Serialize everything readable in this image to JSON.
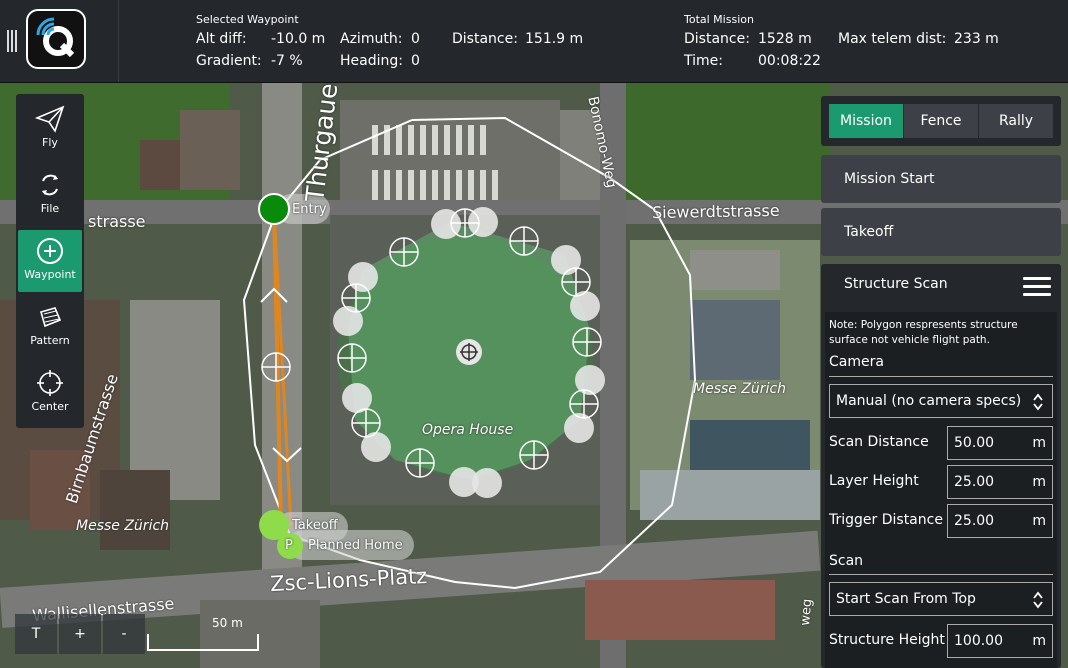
{
  "selected_waypoint": {
    "header": "Selected Waypoint",
    "alt_diff_label": "Alt diff:",
    "alt_diff_value": "-10.0 m",
    "azimuth_label": "Azimuth:",
    "azimuth_value": "0",
    "distance_label": "Distance:",
    "distance_value": "151.9 m",
    "gradient_label": "Gradient:",
    "gradient_value": "-7 %",
    "heading_label": "Heading:",
    "heading_value": "0"
  },
  "total_mission": {
    "header": "Total Mission",
    "distance_label": "Distance:",
    "distance_value": "1528 m",
    "max_telem_label": "Max telem dist:",
    "max_telem_value": "233 m",
    "time_label": "Time:",
    "time_value": "00:08:22"
  },
  "toolstrip": {
    "fly": "Fly",
    "file": "File",
    "waypoint": "Waypoint",
    "pattern": "Pattern",
    "center": "Center"
  },
  "tabs": [
    "Mission",
    "Fence",
    "Rally"
  ],
  "mission_items": {
    "mission_start": "Mission Start",
    "takeoff": "Takeoff"
  },
  "structure_scan": {
    "title": "Structure Scan",
    "note": "Note: Polygon respresents structure surface not vehicle flight path.",
    "camera_section": "Camera",
    "camera_value": "Manual (no camera specs)",
    "scan_distance_label": "Scan Distance",
    "scan_distance_value": "50.00",
    "layer_height_label": "Layer Height",
    "layer_height_value": "25.00",
    "trigger_distance_label": "Trigger Distance",
    "trigger_distance_value": "25.00",
    "unit": "m",
    "scan_section": "Scan",
    "scan_from_value": "Start Scan From Top",
    "structure_height_label": "Structure Height",
    "structure_height_value": "100.00"
  },
  "map": {
    "labels": {
      "thurgauerstrasse": "Thurgauerstrasse",
      "siewerdtstrasse": "Siewerdtstrasse",
      "bonomo_weg": "Bonomo-Weg",
      "birnbaumstrasse": "Birnbaumstrasse",
      "messe_zurich_1": "Messe Zürich",
      "messe_zurich_2": "Messe Zürich",
      "opera_house": "Opera House",
      "zsc_lions_platz": "Zsc-Lions-Platz",
      "wallisellenstrasse": "Wallisellenstrasse",
      "strasse_left": "strasse",
      "weg_bottom": "weg"
    },
    "markers": {
      "entry": "Entry",
      "takeoff": "Takeoff",
      "planned_home_letter": "P",
      "planned_home": "Planned Home"
    },
    "zoom": {
      "tilt": "T",
      "zoom_in": "+",
      "zoom_out": "-"
    },
    "scale_label": "50 m"
  },
  "colors": {
    "accent": "#1a9a6e",
    "panel": "#24272b",
    "item": "#3d4147"
  }
}
